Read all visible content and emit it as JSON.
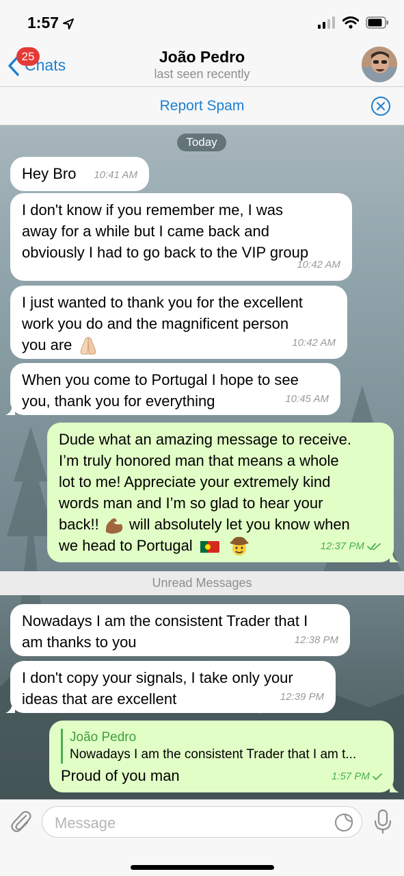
{
  "status_bar": {
    "time": "1:57"
  },
  "nav": {
    "back_label": "Chats",
    "unread_badge": "25",
    "contact_name": "João Pedro",
    "contact_status": "last seen recently"
  },
  "spam_bar": {
    "label": "Report Spam"
  },
  "chat": {
    "date_label": "Today",
    "unread_label": "Unread Messages",
    "messages": [
      {
        "direction": "incoming",
        "lines": [
          "Hey Bro"
        ],
        "time": "10:41 AM"
      },
      {
        "direction": "incoming",
        "lines": [
          "I don't know if you remember me, I was",
          "away for a while but I came back and",
          "obviously I had to go back to the VIP group"
        ],
        "time": "10:42 AM"
      },
      {
        "direction": "incoming",
        "lines": [
          "I just wanted to thank you for the excellent",
          "work you do and the magnificent person",
          "you are"
        ],
        "emoji": [
          "folded-hands"
        ],
        "time": "10:42 AM"
      },
      {
        "direction": "incoming",
        "lines": [
          "When you come to Portugal I hope to see",
          "you, thank you for everything"
        ],
        "time": "10:45 AM"
      },
      {
        "direction": "outgoing",
        "lines": [
          "Dude what an amazing message to receive.",
          "I’m truly honored man that means a whole",
          "lot to me! Appreciate your extremely kind",
          "words man and I’m so glad to hear your",
          "back!!",
          "will absolutely let you know when",
          "we head to Portugal"
        ],
        "emoji": [
          "flexed-biceps",
          "portugal-flag",
          "cowboy-face"
        ],
        "time": "12:37 PM",
        "status": "read"
      },
      {
        "direction": "incoming",
        "lines": [
          "Nowadays I am the consistent Trader that I",
          "am thanks to you"
        ],
        "time": "12:38 PM"
      },
      {
        "direction": "incoming",
        "lines": [
          "I don't copy your signals, I take only your",
          "ideas that are excellent"
        ],
        "time": "12:39 PM"
      },
      {
        "direction": "outgoing",
        "reply_to": {
          "name": "João Pedro",
          "text": "Nowadays I am the consistent Trader that I am t..."
        },
        "lines": [
          "Proud of you man"
        ],
        "time": "1:57 PM",
        "status": "delivered"
      }
    ]
  },
  "input": {
    "placeholder": "Message"
  },
  "icons": {
    "status": [
      "location-arrow-icon",
      "signal-icon",
      "wifi-icon",
      "battery-icon"
    ],
    "nav": [
      "chevron-left-icon",
      "avatar"
    ],
    "spam": [
      "close-circle-icon"
    ],
    "input": [
      "paperclip-icon",
      "sticker-icon",
      "microphone-icon"
    ]
  },
  "colors": {
    "accent": "#1a7fd1",
    "outgoing_bubble": "#e1fec6",
    "incoming_bubble": "#ffffff",
    "badge": "#e53935",
    "read_check": "#4caf50"
  }
}
